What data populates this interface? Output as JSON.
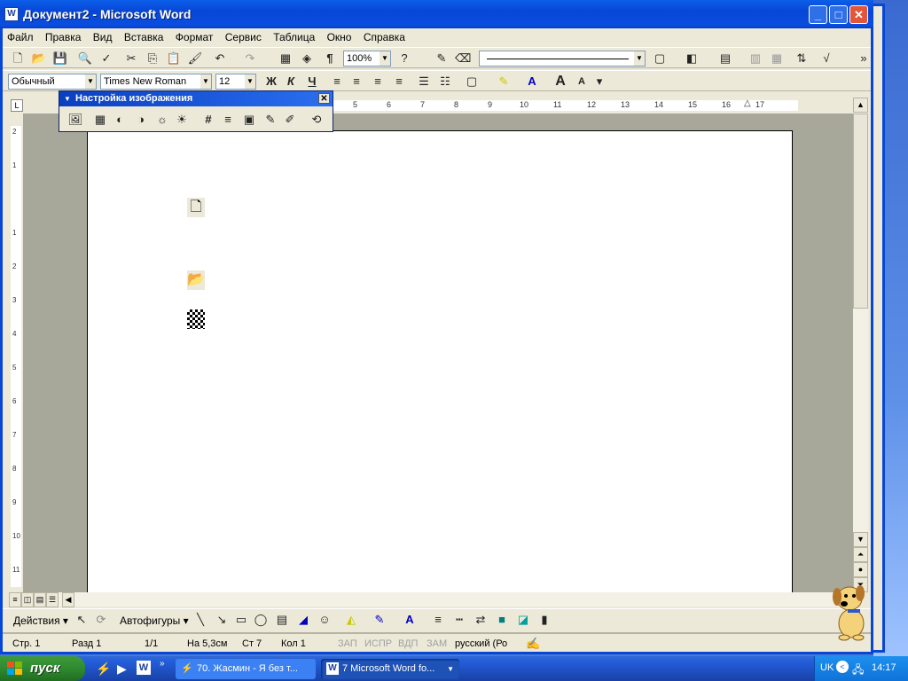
{
  "window": {
    "title": "Документ2 - Microsoft Word",
    "icon": "word-doc-icon"
  },
  "menu": [
    "Файл",
    "Правка",
    "Вид",
    "Вставка",
    "Формат",
    "Сервис",
    "Таблица",
    "Окно",
    "Справка"
  ],
  "standard_toolbar": {
    "zoom": "100%"
  },
  "formatting_toolbar": {
    "style": "Обычный",
    "font": "Times New Roman",
    "size": "12",
    "bold": "Ж",
    "italic": "К",
    "underline": "Ч"
  },
  "picture_toolbar": {
    "title": "Настройка изображения",
    "close": "✕"
  },
  "ruler": {
    "labels": [
      "5",
      "6",
      "7",
      "8",
      "9",
      "10",
      "11",
      "12",
      "13",
      "14",
      "15",
      "16",
      "17"
    ]
  },
  "vruler": {
    "labels": [
      "2",
      "1",
      "1",
      "2",
      "3",
      "4",
      "5",
      "6",
      "7",
      "8",
      "9",
      "10",
      "11"
    ]
  },
  "drawing_toolbar": {
    "actions": "Действия",
    "autoshapes": "Автофигуры"
  },
  "status_bar": {
    "page": "Стр. 1",
    "section": "Разд 1",
    "pages": "1/1",
    "at": "На 5,3см",
    "line": "Ст 7",
    "col": "Кол 1",
    "rec": "ЗАП",
    "trk": "ИСПР",
    "ext": "ВДП",
    "ovr": "ЗАМ",
    "lang": "русский (Ро"
  },
  "taskbar": {
    "start": "пуск",
    "tasks": [
      "70. Жасмин - Я без т...",
      "7 Microsoft Word fo..."
    ],
    "lang": "UK",
    "clock": "14:17"
  },
  "colors": {
    "title_blue": "#0846d6",
    "start_green": "#2f8a2f",
    "close_red": "#e2563a"
  }
}
